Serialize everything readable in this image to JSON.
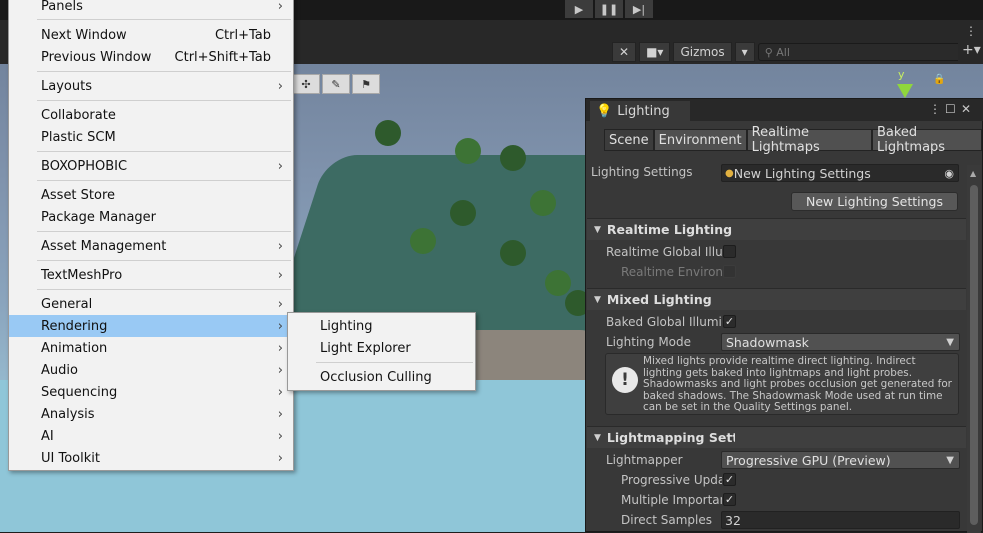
{
  "toolbar": {
    "play_icons": [
      "play-icon",
      "pause-icon",
      "step-icon"
    ],
    "gizmos_label": "Gizmos",
    "search_placeholder": "All",
    "axis_label": "y"
  },
  "menu": {
    "items": [
      {
        "label": "Panels",
        "shortcut": "",
        "submenu": true
      },
      {
        "label": "Next Window",
        "shortcut": "Ctrl+Tab",
        "submenu": false
      },
      {
        "label": "Previous Window",
        "shortcut": "Ctrl+Shift+Tab",
        "submenu": false
      },
      {
        "label": "Layouts",
        "shortcut": "",
        "submenu": true
      },
      {
        "label": "Collaborate",
        "shortcut": "",
        "submenu": false
      },
      {
        "label": "Plastic SCM",
        "shortcut": "",
        "submenu": false
      },
      {
        "label": "BOXOPHOBIC",
        "shortcut": "",
        "submenu": true
      },
      {
        "label": "Asset Store",
        "shortcut": "",
        "submenu": false
      },
      {
        "label": "Package Manager",
        "shortcut": "",
        "submenu": false
      },
      {
        "label": "Asset Management",
        "shortcut": "",
        "submenu": true
      },
      {
        "label": "TextMeshPro",
        "shortcut": "",
        "submenu": true
      },
      {
        "label": "General",
        "shortcut": "",
        "submenu": true
      },
      {
        "label": "Rendering",
        "shortcut": "",
        "submenu": true
      },
      {
        "label": "Animation",
        "shortcut": "",
        "submenu": true
      },
      {
        "label": "Audio",
        "shortcut": "",
        "submenu": true
      },
      {
        "label": "Sequencing",
        "shortcut": "",
        "submenu": true
      },
      {
        "label": "Analysis",
        "shortcut": "",
        "submenu": true
      },
      {
        "label": "AI",
        "shortcut": "",
        "submenu": true
      },
      {
        "label": "UI Toolkit",
        "shortcut": "",
        "submenu": true
      }
    ],
    "selected": "Rendering"
  },
  "submenu": {
    "items": [
      "Lighting",
      "Light Explorer",
      "Occlusion Culling"
    ]
  },
  "lighting": {
    "title": "Lighting",
    "tabs": [
      "Scene",
      "Environment",
      "Realtime Lightmaps",
      "Baked Lightmaps"
    ],
    "active_tab": "Scene",
    "settings_label": "Lighting Settings",
    "settings_value": "New Lighting Settings",
    "new_button": "New Lighting Settings",
    "realtime_header": "Realtime Lighting",
    "realtime_gi_label": "Realtime Global Illum",
    "realtime_env_label": "Realtime Environm",
    "mixed_header": "Mixed Lighting",
    "baked_gi_label": "Baked Global Illumin",
    "lighting_mode_label": "Lighting Mode",
    "lighting_mode_value": "Shadowmask",
    "info_text": "Mixed lights provide realtime direct lighting. Indirect lighting gets baked into lightmaps and light probes. Shadowmasks and light probes occlusion get generated for baked shadows. The Shadowmask Mode used at run time can be set in the Quality Settings panel.",
    "lightmapping_header": "Lightmapping Settings",
    "lightmapper_label": "Lightmapper",
    "lightmapper_value": "Progressive GPU (Preview)",
    "progressive_label": "Progressive Upda",
    "multiple_label": "Multiple Importanc",
    "direct_samples_label": "Direct Samples",
    "direct_samples_value": "32"
  }
}
